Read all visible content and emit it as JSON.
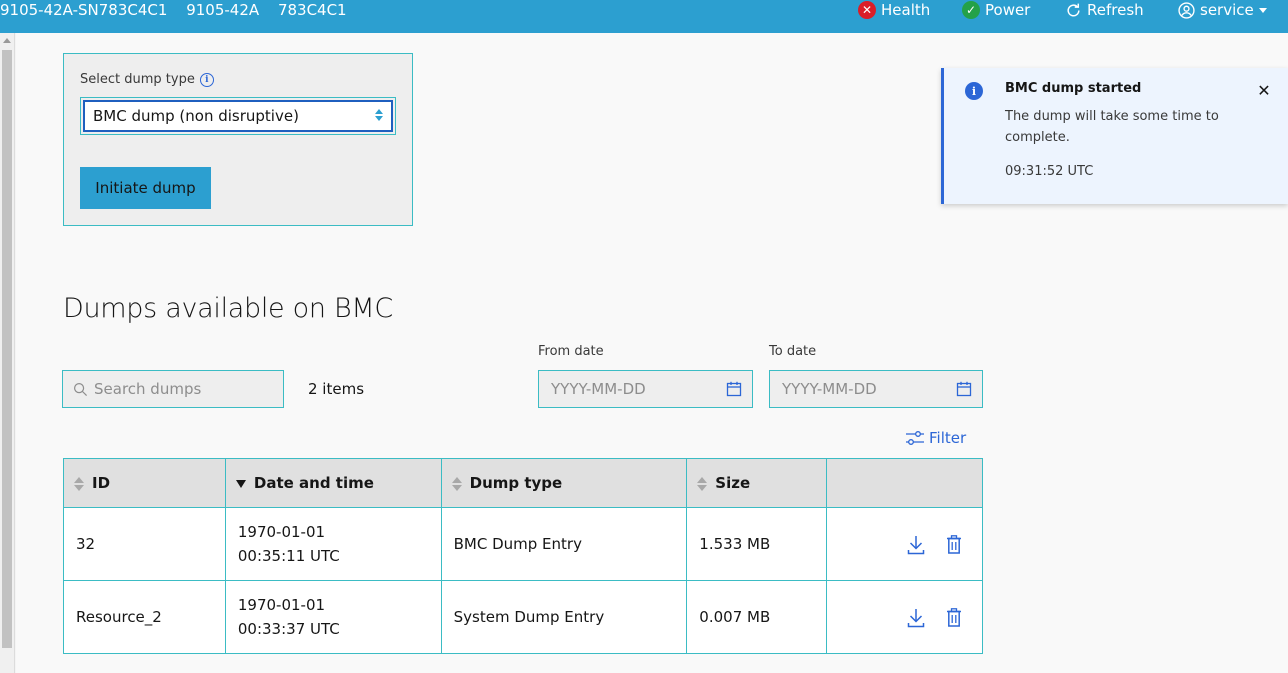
{
  "header": {
    "ids": [
      "9105-42A-SN783C4C1",
      "9105-42A",
      "783C4C1"
    ],
    "health_label": "Health",
    "power_label": "Power",
    "refresh_label": "Refresh",
    "user_label": "service",
    "colors": {
      "bar": "#2c9fd0",
      "health": "#da1e28",
      "power": "#24a148"
    }
  },
  "initiate": {
    "select_label": "Select dump type",
    "selected_type": "BMC dump (non disruptive)",
    "button_label": "Initiate dump"
  },
  "toast": {
    "title": "BMC dump started",
    "body": "The dump will take some time to complete.",
    "time": "09:31:52 UTC",
    "close": "✕"
  },
  "dumps": {
    "title": "Dumps available on BMC",
    "search_placeholder": "Search dumps",
    "items_count": "2 items",
    "from_label": "From date",
    "to_label": "To date",
    "date_placeholder": "YYYY-MM-DD",
    "filter_label": "Filter",
    "columns": [
      "ID",
      "Date and time",
      "Dump type",
      "Size"
    ],
    "rows": [
      {
        "id": "32",
        "date": "1970-01-01",
        "time": "00:35:11 UTC",
        "type": "BMC Dump Entry",
        "size": "1.533 MB"
      },
      {
        "id": "Resource_2",
        "date": "1970-01-01",
        "time": "00:33:37 UTC",
        "type": "System Dump Entry",
        "size": "0.007 MB"
      }
    ]
  }
}
